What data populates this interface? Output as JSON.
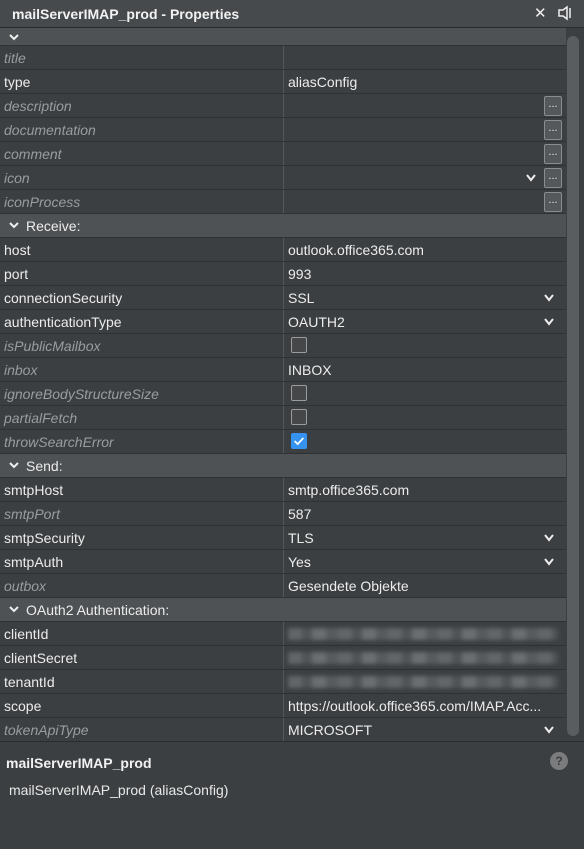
{
  "window": {
    "title": "mailServerIMAP_prod - Properties",
    "close_icon": "close-icon",
    "pin_icon": "pin-icon"
  },
  "rows": {
    "title": {
      "name": "title",
      "value": ""
    },
    "type": {
      "name": "type",
      "value": "aliasConfig"
    },
    "description": {
      "name": "description",
      "value": "",
      "button": "..."
    },
    "documentation": {
      "name": "documentation",
      "value": "",
      "button": "..."
    },
    "comment": {
      "name": "comment",
      "value": "",
      "button": "..."
    },
    "icon": {
      "name": "icon",
      "value": "",
      "button": "..."
    },
    "iconProcess": {
      "name": "iconProcess",
      "value": "",
      "button": "..."
    },
    "receive": {
      "label": "Receive:"
    },
    "host": {
      "name": "host",
      "value": "outlook.office365.com"
    },
    "port": {
      "name": "port",
      "value": "993"
    },
    "connectionSecurity": {
      "name": "connectionSecurity",
      "value": "SSL"
    },
    "authenticationType": {
      "name": "authenticationType",
      "value": "OAUTH2"
    },
    "isPublicMailbox": {
      "name": "isPublicMailbox",
      "checked": false
    },
    "inbox": {
      "name": "inbox",
      "value": "INBOX"
    },
    "ignoreBodyStructureSize": {
      "name": "ignoreBodyStructureSize",
      "checked": false
    },
    "partialFetch": {
      "name": "partialFetch",
      "checked": false
    },
    "throwSearchError": {
      "name": "throwSearchError",
      "checked": true
    },
    "send": {
      "label": "Send:"
    },
    "smtpHost": {
      "name": "smtpHost",
      "value": "smtp.office365.com"
    },
    "smtpPort": {
      "name": "smtpPort",
      "value": "587"
    },
    "smtpSecurity": {
      "name": "smtpSecurity",
      "value": "TLS"
    },
    "smtpAuth": {
      "name": "smtpAuth",
      "value": "Yes"
    },
    "outbox": {
      "name": "outbox",
      "value": "Gesendete Objekte"
    },
    "oauth": {
      "label": "OAuth2 Authentication:"
    },
    "clientId": {
      "name": "clientId",
      "redacted": true
    },
    "clientSecret": {
      "name": "clientSecret",
      "redacted": true
    },
    "tenantId": {
      "name": "tenantId",
      "redacted": true
    },
    "scope": {
      "name": "scope",
      "value": "https://outlook.office365.com/IMAP.Acc..."
    },
    "tokenApiType": {
      "name": "tokenApiType",
      "value": "MICROSOFT"
    }
  },
  "footer": {
    "name": "mailServerIMAP_prod",
    "description": "mailServerIMAP_prod (aliasConfig)",
    "help_icon": "?"
  },
  "colors": {
    "checkbox_checked": "#3592ee",
    "background": "#3c3f41",
    "category_bg": "#4e5254"
  }
}
